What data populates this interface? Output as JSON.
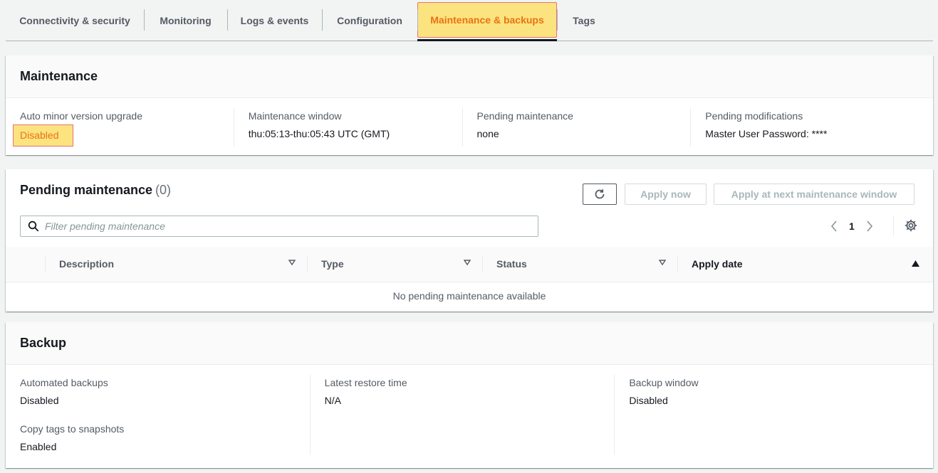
{
  "tabs": [
    {
      "label": "Connectivity & security"
    },
    {
      "label": "Monitoring"
    },
    {
      "label": "Logs & events"
    },
    {
      "label": "Configuration"
    },
    {
      "label": "Maintenance & backups",
      "active": true
    },
    {
      "label": "Tags"
    }
  ],
  "maintenance": {
    "title": "Maintenance",
    "auto_minor_label": "Auto minor version upgrade",
    "auto_minor_value": "Disabled",
    "window_label": "Maintenance window",
    "window_value": "thu:05:13-thu:05:43 UTC (GMT)",
    "pending_label": "Pending maintenance",
    "pending_value": "none",
    "modifications_label": "Pending modifications",
    "modifications_value": "Master User Password: ****"
  },
  "pending": {
    "title": "Pending maintenance",
    "count": "(0)",
    "refresh_icon": "refresh-icon",
    "apply_now_label": "Apply now",
    "apply_next_label": "Apply at next maintenance window",
    "search_placeholder": "Filter pending maintenance",
    "page_number": "1",
    "columns": [
      "Description",
      "Type",
      "Status",
      "Apply date"
    ],
    "empty_message": "No pending maintenance available"
  },
  "backup": {
    "title": "Backup",
    "automated_label": "Automated backups",
    "automated_value": "Disabled",
    "copy_tags_label": "Copy tags to snapshots",
    "copy_tags_value": "Enabled",
    "restore_label": "Latest restore time",
    "restore_value": "N/A",
    "window_label": "Backup window",
    "window_value": "Disabled"
  },
  "colors": {
    "highlight": "#fbe380",
    "highlight_border": "#e57373",
    "accent": "#ec7211",
    "text": "#16191f",
    "muted": "#545b64"
  }
}
